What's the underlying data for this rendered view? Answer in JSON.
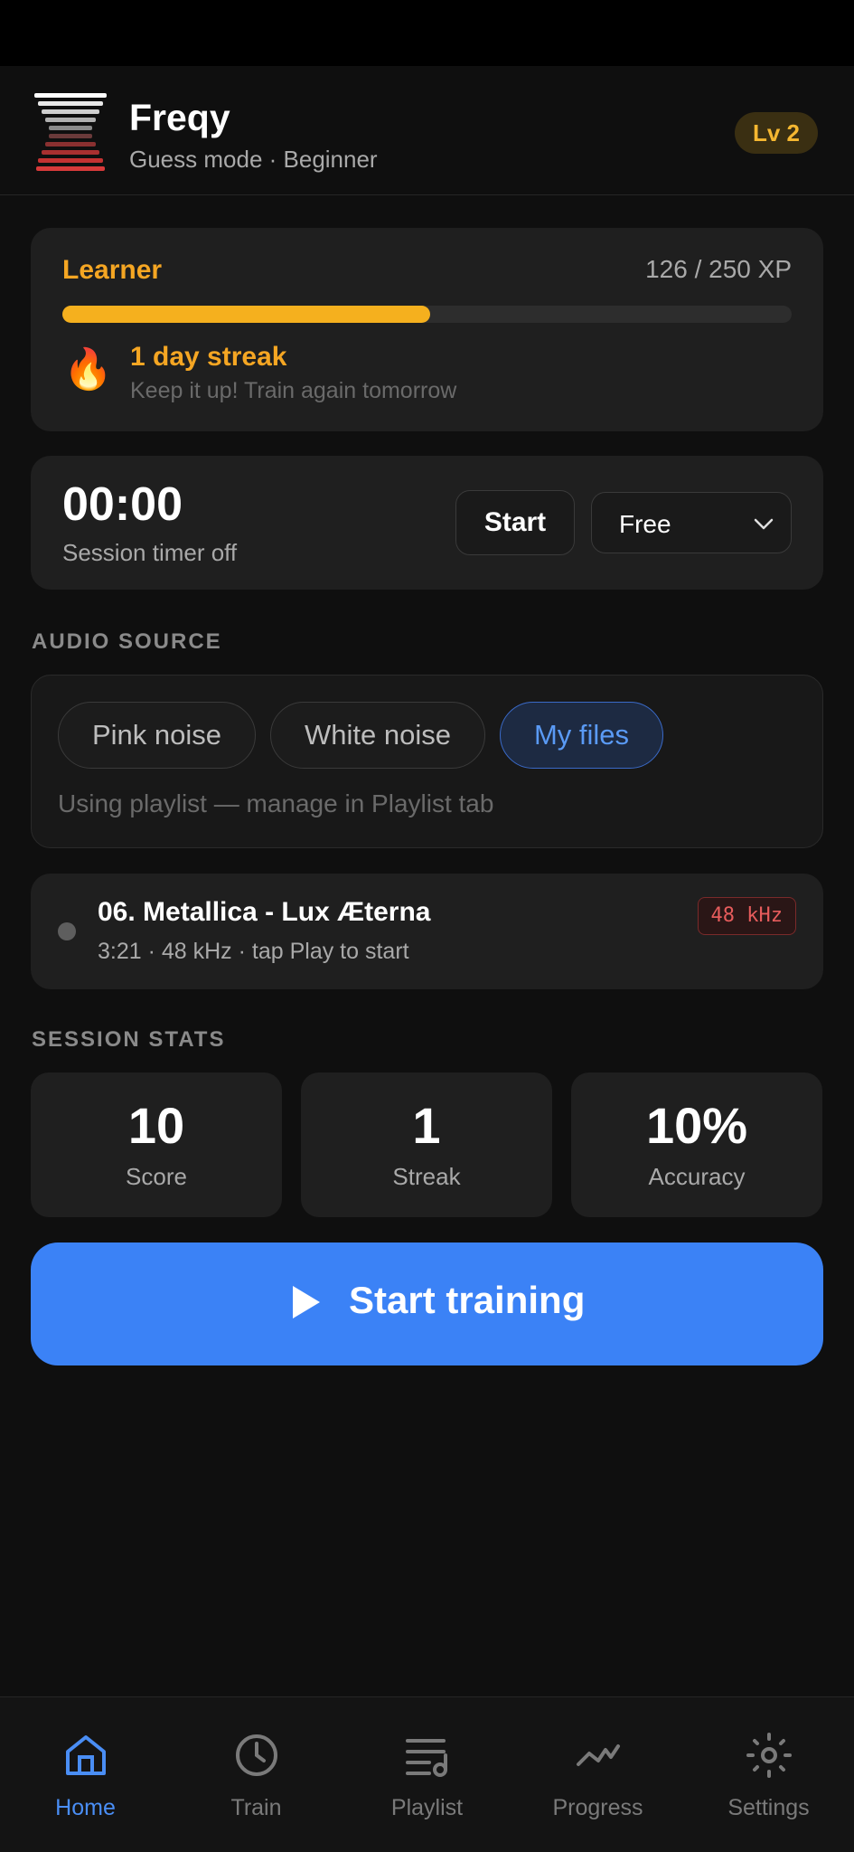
{
  "header": {
    "app_name": "Freqy",
    "subtitle": "Guess mode · Beginner",
    "level": "Lv 2",
    "logo_icon": "freqy-stack-logo"
  },
  "xp": {
    "rank": "Learner",
    "progress_text": "126 / 250 XP",
    "current": 126,
    "target": 250,
    "streak_title": "1 day streak",
    "streak_subtitle": "Keep it up! Train again tomorrow",
    "streak_icon": "🔥"
  },
  "timer": {
    "value": "00:00",
    "label": "Session timer off",
    "start_label": "Start",
    "mode_value": "Free"
  },
  "audio_source": {
    "section_title": "AUDIO SOURCE",
    "options": [
      "Pink noise",
      "White noise",
      "My files"
    ],
    "selected": "My files",
    "hint": "Using playlist — manage in Playlist tab"
  },
  "track": {
    "title": "06. Metallica - Lux Æterna",
    "meta": "3:21 · 48 kHz · tap Play to start",
    "sample_rate_badge": "48 kHz"
  },
  "stats": {
    "section_title": "SESSION STATS",
    "score_value": "10",
    "score_label": "Score",
    "streak_value": "1",
    "streak_label": "Streak",
    "accuracy_value": "10%",
    "accuracy_label": "Accuracy"
  },
  "cta": {
    "label": "Start training"
  },
  "tabs": [
    {
      "label": "Home",
      "icon": "home-icon",
      "active": true
    },
    {
      "label": "Train",
      "icon": "clock-icon",
      "active": false
    },
    {
      "label": "Playlist",
      "icon": "playlist-icon",
      "active": false
    },
    {
      "label": "Progress",
      "icon": "progress-icon",
      "active": false
    },
    {
      "label": "Settings",
      "icon": "gear-icon",
      "active": false
    }
  ],
  "colors": {
    "accent_blue": "#3b82f6",
    "accent_orange": "#f5a623",
    "background": "#0f0f0f",
    "card": "#1f1f1f"
  }
}
